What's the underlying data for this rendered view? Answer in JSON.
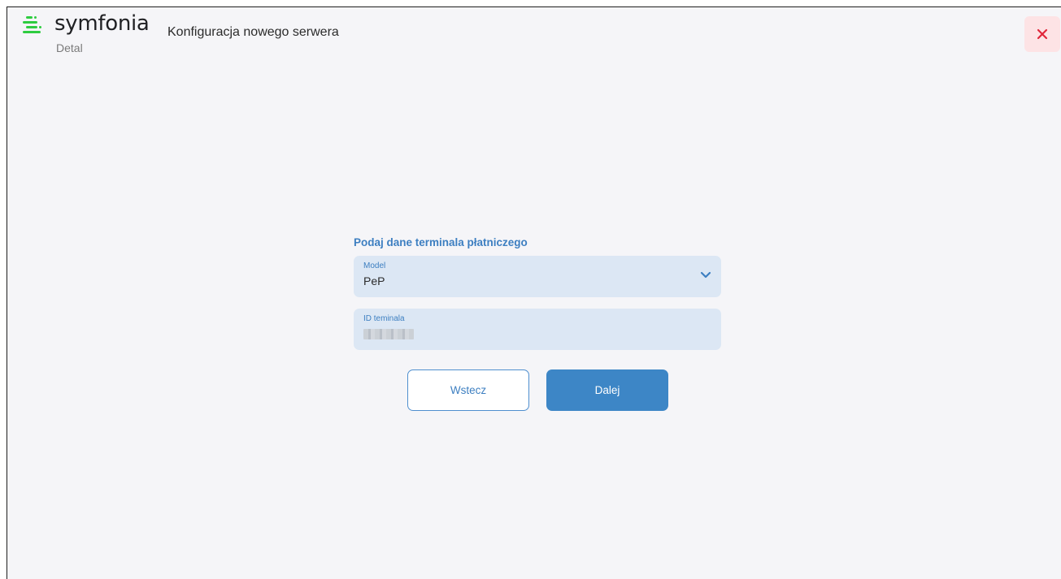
{
  "app": {
    "brand_name": "symfonia",
    "brand_sub": "Detal",
    "accent_color": "#3d86c6",
    "brand_green": "#2ecc40"
  },
  "header": {
    "title": "Konfiguracja nowego serwera",
    "close_icon": "close-icon"
  },
  "form": {
    "title": "Podaj dane terminala płatniczego",
    "model": {
      "label": "Model",
      "value": "PeP",
      "icon": "chevron-down-icon"
    },
    "terminal_id": {
      "label": "ID teminala",
      "value": ""
    }
  },
  "buttons": {
    "back_label": "Wstecz",
    "next_label": "Dalej"
  }
}
